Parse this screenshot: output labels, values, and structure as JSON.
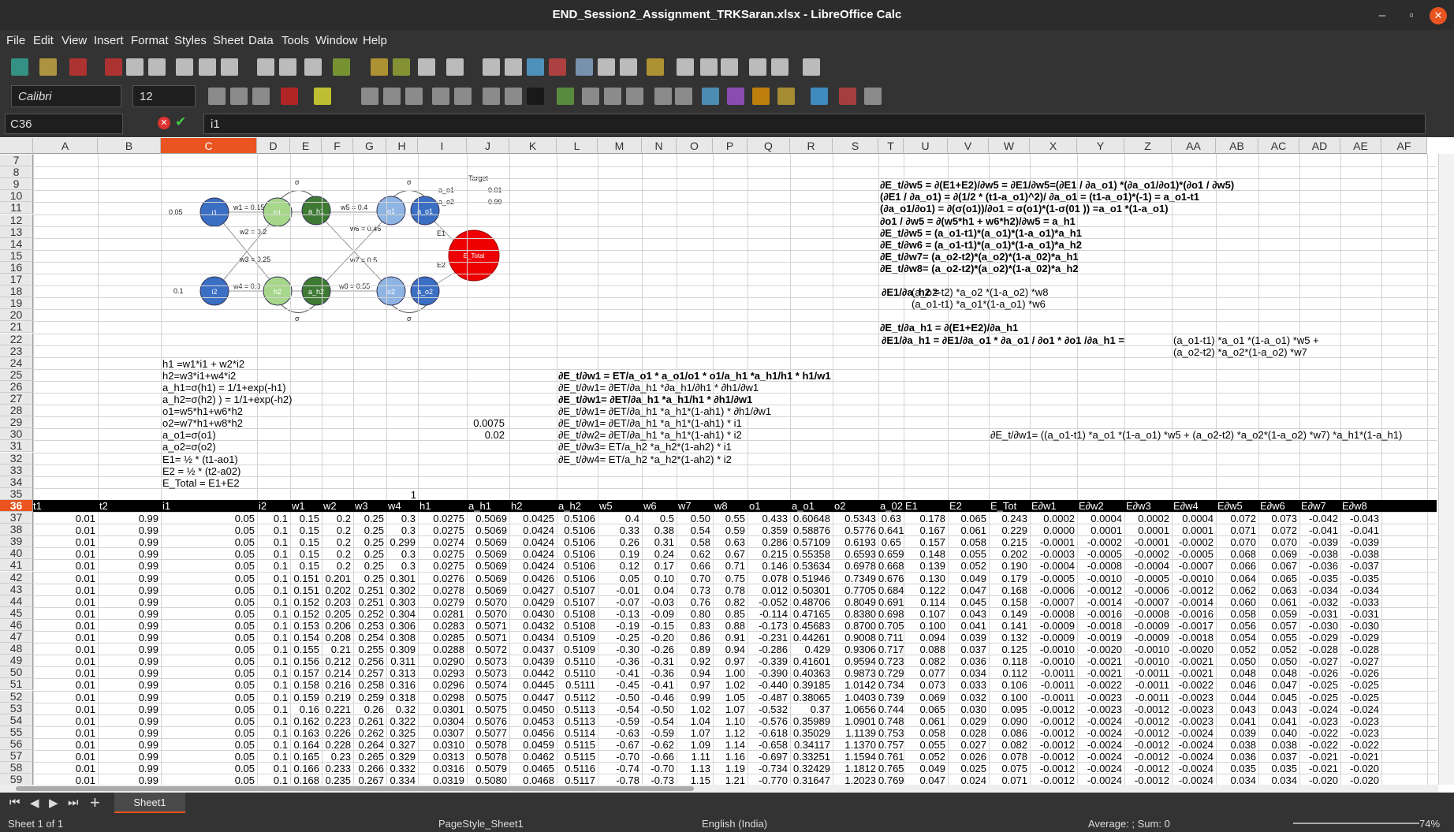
{
  "window": {
    "title": "END_Session2_Assignment_TRKSaran.xlsx - LibreOffice Calc",
    "minimize": "–",
    "maximize": "▫",
    "close": "✕"
  },
  "menu": [
    "File",
    "Edit",
    "View",
    "Insert",
    "Format",
    "Styles",
    "Sheet",
    "Data",
    "Tools",
    "Window",
    "Help"
  ],
  "font": {
    "name": "Calibri",
    "size": "12"
  },
  "namebox": "C36",
  "formula": "i1",
  "columns": [
    "A",
    "B",
    "C",
    "D",
    "E",
    "F",
    "G",
    "H",
    "I",
    "J",
    "K",
    "L",
    "M",
    "N",
    "O",
    "P",
    "Q",
    "R",
    "S",
    "T",
    "U",
    "V",
    "W",
    "X",
    "Y",
    "Z",
    "AA",
    "AB",
    "AC",
    "AD",
    "AE",
    "AF"
  ],
  "rows": [
    "7",
    "8",
    "9",
    "10",
    "11",
    "12",
    "13",
    "14",
    "15",
    "16",
    "17",
    "18",
    "19",
    "20",
    "21",
    "22",
    "23",
    "24",
    "25",
    "26",
    "27",
    "28",
    "29",
    "30",
    "31",
    "32",
    "33",
    "34",
    "35",
    "36",
    "37",
    "38",
    "39",
    "40",
    "41",
    "42",
    "43",
    "44",
    "45",
    "46",
    "47",
    "48",
    "49",
    "50",
    "51",
    "52",
    "53",
    "54",
    "55",
    "56",
    "57",
    "58",
    "59",
    "60"
  ],
  "diagram": {
    "target": "Target",
    "ao1": "a_o1",
    "ao2": "a_o2",
    "t1": "0.01",
    "t2": "0.99",
    "i1": "i1",
    "i2": "i2",
    "i1v": "0.05",
    "i2v": "0.1",
    "h1": "h1",
    "h2": "h2",
    "ah1": "a_h1",
    "ah2": "a_h2",
    "o1": "o1",
    "o2": "o2",
    "ao1n": "a_o1",
    "ao2n": "a_o2",
    "etot": "E_Total",
    "e1": "E1",
    "e2": "E2",
    "w1": "w1 = 0.15",
    "w2": "w2 = 0.2",
    "w3": "w3 = 0.25",
    "w4": "w4 = 0.3",
    "w5": "w5 = 0.4",
    "w6": "w6 = 0.45",
    "w7": "w7 = 0.5",
    "w8": "w8 = 0.55",
    "sig": "σ"
  },
  "formulas_c": [
    "h1 =w1*i1 + w2*i2",
    "h2=w3*i1+w4*i2",
    "a_h1=σ(h1) = 1/1+exp(-h1)",
    "a_h2=σ(h2) ) = 1/1+exp(-h2)",
    "o1=w5*h1+w6*h2",
    "o2=w7*h1+w8*h2",
    "a_o1=σ(o1)",
    "a_o2=σ(o2)",
    "E1= ½ * (t1-ao1)",
    "E2 = ½ * (t2-a02)",
    "E_Total = E1+E2"
  ],
  "i29": "0.0075",
  "i30": "0.02",
  "h35": "1",
  "formulas_l": [
    "∂E_t/∂w1 = ET/a_o1 * a_o1/o1 * o1/a_h1 *a_h1/h1 * h1/w1",
    "∂E_t/∂w1= ∂ET/∂a_h1 *∂a_h1/∂h1 * ∂h1/∂w1",
    "∂E_t/∂w1= ∂ET/∂a_h1 *a_h1/h1 * ∂h1/∂w1",
    "∂E_t/∂w1= ∂ET/∂a_h1 *a_h1*(1-ah1) * ∂h1/∂w1",
    "∂E_t/∂w1= ∂ET/∂a_h1 *a_h1*(1-ah1) * i1",
    "∂E_t/∂w2= ∂ET/∂a_h1 *a_h1*(1-ah1) * i2",
    "∂E_t/∂w3= ET/a_h2 *a_h2*(1-ah2) * i1",
    "∂E_t/∂w4= ET/a_h2 *a_h2*(1-ah2) * i2"
  ],
  "formulas_t": [
    "∂E_t/∂w5 = ∂(E1+E2)/∂w5 =  ∂E1/∂w5=(∂E1 / ∂a_o1) *(∂a_o1/∂o1)*(∂o1 / ∂w5)",
    "(∂E1 / ∂a_o1) = ∂(1/2 * (t1-a_o1)^2)/ ∂a_o1 = (t1-a_o1)*(-1) = a_o1-t1",
    "(∂a_o1/∂o1) = ∂(σ(o1))/∂o1 = σ(o1)*(1-σ(01 )) =a_o1 *(1-a_o1)",
    "∂o1 / ∂w5 = ∂(w5*h1 + w6*h2)/∂w5 = a_h1",
    "∂E_t/∂w5  = (a_o1-t1)*(a_o1)*(1-a_o1)*a_h1",
    "∂E_t/∂w6 = (a_o1-t1)*(a_o1)*(1-a_o1)*a_h2",
    "∂E_t/∂w7= (a_o2-t2)*(a_o2)*(1-a_02)*a_h1",
    "∂E_t/∂w8= (a_o2-t2)*(a_o2)*(1-a_02)*a_h2"
  ],
  "dEdah2": "∂E1/∂a_h2 =",
  "dEdah2_v1": "(a_o2-t2) *a_o2 *(1-a_o2) *w8",
  "dEdah2_v2": "(a_o1-t1) *a_o1*(1-a_o1) *w6",
  "dEdah1": "∂E_t/∂a_h1 = ∂(E1+E2)/∂a_h1",
  "dEdah1b": "∂E1/∂a_h1 = ∂E1/∂a_o1 * ∂a_o1 / ∂o1 * ∂o1 /∂a_h1 =",
  "dEdah1_v1": "(a_o1-t1) *a_o1 *(1-a_o1) *w5 +",
  "dEdah1_v2": "(a_o2-t2) *a_o2*(1-a_o2) *w7",
  "w30": "∂E_t/∂w1= ((a_o1-t1) *a_o1 *(1-a_o1) *w5 +  (a_o2-t2) *a_o2*(1-a_o2) *w7) *a_h1*(1-a_h1)",
  "headers": [
    "t1",
    "t2",
    "i1",
    "i2",
    "w1",
    "w2",
    "w3",
    "w4",
    "h1",
    "a_h1",
    "h2",
    "a_h2",
    "w5",
    "w6",
    "w7",
    "w8",
    "o1",
    "a_o1",
    "o2",
    "a_02",
    "E1",
    "E2",
    "E_Tot",
    "E∂w1",
    "E∂w2",
    "E∂w3",
    "E∂w4",
    "E∂w5",
    "E∂w6",
    "E∂w7",
    "E∂w8"
  ],
  "table": [
    [
      "0.01",
      "0.99",
      "0.05",
      "0.1",
      "0.15",
      "0.2",
      "0.25",
      "0.3",
      "0.0275",
      "0.5069",
      "0.0425",
      "0.5106",
      "0.4",
      "0.5",
      "0.50",
      "0.55",
      "0.433",
      "0.60648",
      "0.5343",
      "0.63",
      "0.178",
      "0.065",
      "0.243",
      "0.0002",
      "0.0004",
      "0.0002",
      "0.0004",
      "0.072",
      "0.073",
      "-0.042",
      "-0.043"
    ],
    [
      "0.01",
      "0.99",
      "0.05",
      "0.1",
      "0.15",
      "0.2",
      "0.25",
      "0.3",
      "0.0275",
      "0.5069",
      "0.0424",
      "0.5106",
      "0.33",
      "0.38",
      "0.54",
      "0.59",
      "0.359",
      "0.58876",
      "0.5776",
      "0.641",
      "0.167",
      "0.061",
      "0.229",
      "0.0000",
      "0.0001",
      "0.0001",
      "0.0001",
      "0.071",
      "0.072",
      "-0.041",
      "-0.041"
    ],
    [
      "0.01",
      "0.99",
      "0.05",
      "0.1",
      "0.15",
      "0.2",
      "0.25",
      "0.299",
      "0.0274",
      "0.5069",
      "0.0424",
      "0.5106",
      "0.26",
      "0.31",
      "0.58",
      "0.63",
      "0.286",
      "0.57109",
      "0.6193",
      "0.65",
      "0.157",
      "0.058",
      "0.215",
      "-0.0001",
      "-0.0002",
      "-0.0001",
      "-0.0002",
      "0.070",
      "0.070",
      "-0.039",
      "-0.039"
    ],
    [
      "0.01",
      "0.99",
      "0.05",
      "0.1",
      "0.15",
      "0.2",
      "0.25",
      "0.3",
      "0.0275",
      "0.5069",
      "0.0424",
      "0.5106",
      "0.19",
      "0.24",
      "0.62",
      "0.67",
      "0.215",
      "0.55358",
      "0.6593",
      "0.659",
      "0.148",
      "0.055",
      "0.202",
      "-0.0003",
      "-0.0005",
      "-0.0002",
      "-0.0005",
      "0.068",
      "0.069",
      "-0.038",
      "-0.038"
    ],
    [
      "0.01",
      "0.99",
      "0.05",
      "0.1",
      "0.15",
      "0.2",
      "0.25",
      "0.3",
      "0.0275",
      "0.5069",
      "0.0424",
      "0.5106",
      "0.12",
      "0.17",
      "0.66",
      "0.71",
      "0.146",
      "0.53634",
      "0.6978",
      "0.668",
      "0.139",
      "0.052",
      "0.190",
      "-0.0004",
      "-0.0008",
      "-0.0004",
      "-0.0007",
      "0.066",
      "0.067",
      "-0.036",
      "-0.037"
    ],
    [
      "0.01",
      "0.99",
      "0.05",
      "0.1",
      "0.151",
      "0.201",
      "0.25",
      "0.301",
      "0.0276",
      "0.5069",
      "0.0426",
      "0.5106",
      "0.05",
      "0.10",
      "0.70",
      "0.75",
      "0.078",
      "0.51946",
      "0.7349",
      "0.676",
      "0.130",
      "0.049",
      "0.179",
      "-0.0005",
      "-0.0010",
      "-0.0005",
      "-0.0010",
      "0.064",
      "0.065",
      "-0.035",
      "-0.035"
    ],
    [
      "0.01",
      "0.99",
      "0.05",
      "0.1",
      "0.151",
      "0.202",
      "0.251",
      "0.302",
      "0.0278",
      "0.5069",
      "0.0427",
      "0.5107",
      "-0.01",
      "0.04",
      "0.73",
      "0.78",
      "0.012",
      "0.50301",
      "0.7705",
      "0.684",
      "0.122",
      "0.047",
      "0.168",
      "-0.0006",
      "-0.0012",
      "-0.0006",
      "-0.0012",
      "0.062",
      "0.063",
      "-0.034",
      "-0.034"
    ],
    [
      "0.01",
      "0.99",
      "0.05",
      "0.1",
      "0.152",
      "0.203",
      "0.251",
      "0.303",
      "0.0279",
      "0.5070",
      "0.0429",
      "0.5107",
      "-0.07",
      "-0.03",
      "0.76",
      "0.82",
      "-0.052",
      "0.48706",
      "0.8049",
      "0.691",
      "0.114",
      "0.045",
      "0.158",
      "-0.0007",
      "-0.0014",
      "-0.0007",
      "-0.0014",
      "0.060",
      "0.061",
      "-0.032",
      "-0.033"
    ],
    [
      "0.01",
      "0.99",
      "0.05",
      "0.1",
      "0.152",
      "0.205",
      "0.252",
      "0.304",
      "0.0281",
      "0.5070",
      "0.0430",
      "0.5108",
      "-0.13",
      "-0.09",
      "0.80",
      "0.85",
      "-0.114",
      "0.47165",
      "0.8380",
      "0.698",
      "0.107",
      "0.043",
      "0.149",
      "-0.0008",
      "-0.0016",
      "-0.0008",
      "-0.0016",
      "0.058",
      "0.059",
      "-0.031",
      "-0.031"
    ],
    [
      "0.01",
      "0.99",
      "0.05",
      "0.1",
      "0.153",
      "0.206",
      "0.253",
      "0.306",
      "0.0283",
      "0.5071",
      "0.0432",
      "0.5108",
      "-0.19",
      "-0.15",
      "0.83",
      "0.88",
      "-0.173",
      "0.45683",
      "0.8700",
      "0.705",
      "0.100",
      "0.041",
      "0.141",
      "-0.0009",
      "-0.0018",
      "-0.0009",
      "-0.0017",
      "0.056",
      "0.057",
      "-0.030",
      "-0.030"
    ],
    [
      "0.01",
      "0.99",
      "0.05",
      "0.1",
      "0.154",
      "0.208",
      "0.254",
      "0.308",
      "0.0285",
      "0.5071",
      "0.0434",
      "0.5109",
      "-0.25",
      "-0.20",
      "0.86",
      "0.91",
      "-0.231",
      "0.44261",
      "0.9008",
      "0.711",
      "0.094",
      "0.039",
      "0.132",
      "-0.0009",
      "-0.0019",
      "-0.0009",
      "-0.0018",
      "0.054",
      "0.055",
      "-0.029",
      "-0.029"
    ],
    [
      "0.01",
      "0.99",
      "0.05",
      "0.1",
      "0.155",
      "0.21",
      "0.255",
      "0.309",
      "0.0288",
      "0.5072",
      "0.0437",
      "0.5109",
      "-0.30",
      "-0.26",
      "0.89",
      "0.94",
      "-0.286",
      "0.429",
      "0.9306",
      "0.717",
      "0.088",
      "0.037",
      "0.125",
      "-0.0010",
      "-0.0020",
      "-0.0010",
      "-0.0020",
      "0.052",
      "0.052",
      "-0.028",
      "-0.028"
    ],
    [
      "0.01",
      "0.99",
      "0.05",
      "0.1",
      "0.156",
      "0.212",
      "0.256",
      "0.311",
      "0.0290",
      "0.5073",
      "0.0439",
      "0.5110",
      "-0.36",
      "-0.31",
      "0.92",
      "0.97",
      "-0.339",
      "0.41601",
      "0.9594",
      "0.723",
      "0.082",
      "0.036",
      "0.118",
      "-0.0010",
      "-0.0021",
      "-0.0010",
      "-0.0021",
      "0.050",
      "0.050",
      "-0.027",
      "-0.027"
    ],
    [
      "0.01",
      "0.99",
      "0.05",
      "0.1",
      "0.157",
      "0.214",
      "0.257",
      "0.313",
      "0.0293",
      "0.5073",
      "0.0442",
      "0.5110",
      "-0.41",
      "-0.36",
      "0.94",
      "1.00",
      "-0.390",
      "0.40363",
      "0.9873",
      "0.729",
      "0.077",
      "0.034",
      "0.112",
      "-0.0011",
      "-0.0021",
      "-0.0011",
      "-0.0021",
      "0.048",
      "0.048",
      "-0.026",
      "-0.026"
    ],
    [
      "0.01",
      "0.99",
      "0.05",
      "0.1",
      "0.158",
      "0.216",
      "0.258",
      "0.316",
      "0.0296",
      "0.5074",
      "0.0445",
      "0.5111",
      "-0.45",
      "-0.41",
      "0.97",
      "1.02",
      "-0.440",
      "0.39185",
      "1.0142",
      "0.734",
      "0.073",
      "0.033",
      "0.106",
      "-0.0011",
      "-0.0022",
      "-0.0011",
      "-0.0022",
      "0.046",
      "0.047",
      "-0.025",
      "-0.025"
    ],
    [
      "0.01",
      "0.99",
      "0.05",
      "0.1",
      "0.159",
      "0.219",
      "0.259",
      "0.318",
      "0.0298",
      "0.5075",
      "0.0447",
      "0.5112",
      "-0.50",
      "-0.46",
      "0.99",
      "1.05",
      "-0.487",
      "0.38065",
      "1.0403",
      "0.739",
      "0.069",
      "0.032",
      "0.100",
      "-0.0011",
      "-0.0023",
      "-0.0011",
      "-0.0023",
      "0.044",
      "0.045",
      "-0.025",
      "-0.025"
    ],
    [
      "0.01",
      "0.99",
      "0.05",
      "0.1",
      "0.16",
      "0.221",
      "0.26",
      "0.32",
      "0.0301",
      "0.5075",
      "0.0450",
      "0.5113",
      "-0.54",
      "-0.50",
      "1.02",
      "1.07",
      "-0.532",
      "0.37",
      "1.0656",
      "0.744",
      "0.065",
      "0.030",
      "0.095",
      "-0.0012",
      "-0.0023",
      "-0.0012",
      "-0.0023",
      "0.043",
      "0.043",
      "-0.024",
      "-0.024"
    ],
    [
      "0.01",
      "0.99",
      "0.05",
      "0.1",
      "0.162",
      "0.223",
      "0.261",
      "0.322",
      "0.0304",
      "0.5076",
      "0.0453",
      "0.5113",
      "-0.59",
      "-0.54",
      "1.04",
      "1.10",
      "-0.576",
      "0.35989",
      "1.0901",
      "0.748",
      "0.061",
      "0.029",
      "0.090",
      "-0.0012",
      "-0.0024",
      "-0.0012",
      "-0.0023",
      "0.041",
      "0.041",
      "-0.023",
      "-0.023"
    ],
    [
      "0.01",
      "0.99",
      "0.05",
      "0.1",
      "0.163",
      "0.226",
      "0.262",
      "0.325",
      "0.0307",
      "0.5077",
      "0.0456",
      "0.5114",
      "-0.63",
      "-0.59",
      "1.07",
      "1.12",
      "-0.618",
      "0.35029",
      "1.1139",
      "0.753",
      "0.058",
      "0.028",
      "0.086",
      "-0.0012",
      "-0.0024",
      "-0.0012",
      "-0.0024",
      "0.039",
      "0.040",
      "-0.022",
      "-0.023"
    ],
    [
      "0.01",
      "0.99",
      "0.05",
      "0.1",
      "0.164",
      "0.228",
      "0.264",
      "0.327",
      "0.0310",
      "0.5078",
      "0.0459",
      "0.5115",
      "-0.67",
      "-0.62",
      "1.09",
      "1.14",
      "-0.658",
      "0.34117",
      "1.1370",
      "0.757",
      "0.055",
      "0.027",
      "0.082",
      "-0.0012",
      "-0.0024",
      "-0.0012",
      "-0.0024",
      "0.038",
      "0.038",
      "-0.022",
      "-0.022"
    ],
    [
      "0.01",
      "0.99",
      "0.05",
      "0.1",
      "0.165",
      "0.23",
      "0.265",
      "0.329",
      "0.0313",
      "0.5078",
      "0.0462",
      "0.5115",
      "-0.70",
      "-0.66",
      "1.11",
      "1.16",
      "-0.697",
      "0.33251",
      "1.1594",
      "0.761",
      "0.052",
      "0.026",
      "0.078",
      "-0.0012",
      "-0.0024",
      "-0.0012",
      "-0.0024",
      "0.036",
      "0.037",
      "-0.021",
      "-0.021"
    ],
    [
      "0.01",
      "0.99",
      "0.05",
      "0.1",
      "0.166",
      "0.233",
      "0.266",
      "0.332",
      "0.0316",
      "0.5079",
      "0.0465",
      "0.5116",
      "-0.74",
      "-0.70",
      "1.13",
      "1.19",
      "-0.734",
      "0.32429",
      "1.1812",
      "0.765",
      "0.049",
      "0.025",
      "0.075",
      "-0.0012",
      "-0.0024",
      "-0.0012",
      "-0.0024",
      "0.035",
      "0.035",
      "-0.021",
      "-0.020"
    ],
    [
      "0.01",
      "0.99",
      "0.05",
      "0.1",
      "0.168",
      "0.235",
      "0.267",
      "0.334",
      "0.0319",
      "0.5080",
      "0.0468",
      "0.5117",
      "-0.78",
      "-0.73",
      "1.15",
      "1.21",
      "-0.770",
      "0.31647",
      "1.2023",
      "0.769",
      "0.047",
      "0.024",
      "0.071",
      "-0.0012",
      "-0.0024",
      "-0.0012",
      "-0.0024",
      "0.034",
      "0.034",
      "-0.020",
      "-0.020"
    ]
  ],
  "tab": "Sheet1",
  "status": {
    "sheet": "Sheet 1 of 1",
    "style": "PageStyle_Sheet1",
    "lang": "English (India)",
    "sum": "Average: ; Sum: 0",
    "zoom": "74%"
  }
}
